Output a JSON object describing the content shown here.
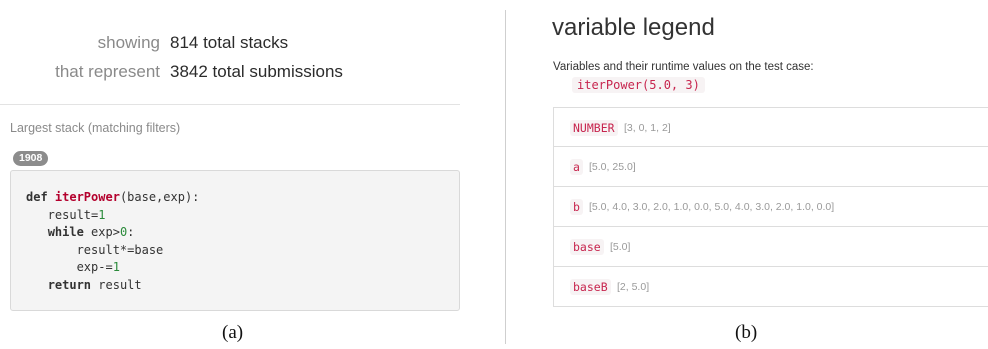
{
  "panel_a": {
    "stats": [
      {
        "key": "showing",
        "value": "814 total stacks"
      },
      {
        "key": "that represent",
        "value": "3842 total submissions"
      }
    ],
    "largest_label": "Largest stack (matching filters)",
    "badge": "1908",
    "code_lines": [
      [
        {
          "t": "def ",
          "c": "kw"
        },
        {
          "t": "iterPower",
          "c": "fn"
        },
        {
          "t": "(base,exp):",
          "c": ""
        }
      ],
      [
        {
          "t": "   result=",
          "c": ""
        },
        {
          "t": "1",
          "c": "num"
        }
      ],
      [
        {
          "t": "   ",
          "c": ""
        },
        {
          "t": "while",
          "c": "kw"
        },
        {
          "t": " exp>",
          "c": ""
        },
        {
          "t": "0",
          "c": "num"
        },
        {
          "t": ":",
          "c": ""
        }
      ],
      [
        {
          "t": "       result*=base",
          "c": ""
        }
      ],
      [
        {
          "t": "       exp-=",
          "c": ""
        },
        {
          "t": "1",
          "c": "num"
        }
      ],
      [
        {
          "t": "   ",
          "c": ""
        },
        {
          "t": "return",
          "c": "kw"
        },
        {
          "t": " result",
          "c": ""
        }
      ]
    ],
    "caption": "(a)"
  },
  "panel_b": {
    "title": "variable legend",
    "subtitle": "Variables and their runtime values on the test case:",
    "test_case": "iterPower(5.0, 3)",
    "variables": [
      {
        "name": "NUMBER",
        "values": "[3, 0, 1, 2]"
      },
      {
        "name": "a",
        "values": "[5.0, 25.0]"
      },
      {
        "name": "b",
        "values": "[5.0, 4.0, 3.0, 2.0, 1.0, 0.0, 5.0, 4.0, 3.0, 2.0, 1.0, 0.0]"
      },
      {
        "name": "base",
        "values": "[5.0]"
      },
      {
        "name": "baseB",
        "values": "[2, 5.0]"
      }
    ],
    "caption": "(b)"
  },
  "colors": {
    "code_keyword": "#333333",
    "function_name": "#b4002d",
    "number_literal": "#2a8a3a",
    "variable_name": "#c7254e",
    "badge_bg": "#8c8c8c"
  }
}
